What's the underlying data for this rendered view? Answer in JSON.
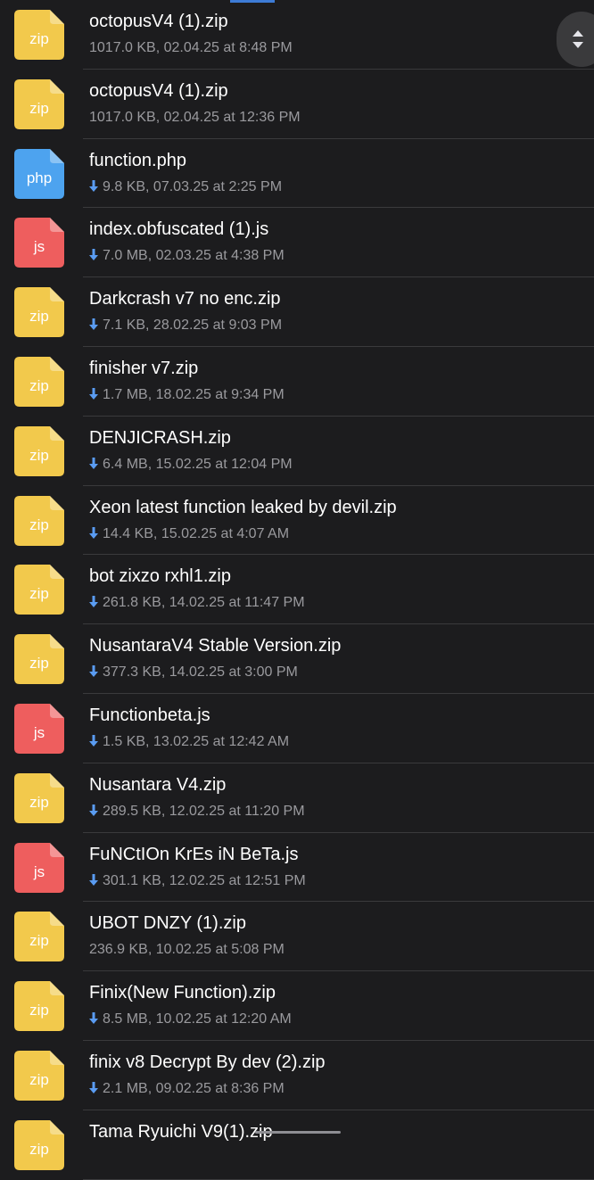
{
  "colors": {
    "zip": "#f2c94c",
    "php": "#4da3ef",
    "js": "#ee5e5e",
    "background": "#1c1c1e",
    "divider": "#3a3a3c",
    "meta_text": "#9a9a9e"
  },
  "files": [
    {
      "name": "octopusV4 (1).zip",
      "meta": "1017.0 KB, 02.04.25 at 8:48 PM",
      "type": "zip",
      "ext_label": "zip",
      "downloaded": false
    },
    {
      "name": "octopusV4 (1).zip",
      "meta": "1017.0 KB, 02.04.25 at 12:36 PM",
      "type": "zip",
      "ext_label": "zip",
      "downloaded": false
    },
    {
      "name": "function.php",
      "meta": "9.8 KB, 07.03.25 at 2:25 PM",
      "type": "php",
      "ext_label": "php",
      "downloaded": true
    },
    {
      "name": "index.obfuscated (1).js",
      "meta": "7.0 MB, 02.03.25 at 4:38 PM",
      "type": "js",
      "ext_label": "js",
      "downloaded": true
    },
    {
      "name": "Darkcrash v7 no enc.zip",
      "meta": "7.1 KB, 28.02.25 at 9:03 PM",
      "type": "zip",
      "ext_label": "zip",
      "downloaded": true
    },
    {
      "name": "finisher v7.zip",
      "meta": "1.7 MB, 18.02.25 at 9:34 PM",
      "type": "zip",
      "ext_label": "zip",
      "downloaded": true
    },
    {
      "name": "DENJICRASH.zip",
      "meta": "6.4 MB, 15.02.25 at 12:04 PM",
      "type": "zip",
      "ext_label": "zip",
      "downloaded": true
    },
    {
      "name": "Xeon latest function leaked by devil.zip",
      "meta": "14.4 KB, 15.02.25 at 4:07 AM",
      "type": "zip",
      "ext_label": "zip",
      "downloaded": true
    },
    {
      "name": "bot zixzo rxhl1.zip",
      "meta": "261.8 KB, 14.02.25 at 11:47 PM",
      "type": "zip",
      "ext_label": "zip",
      "downloaded": true
    },
    {
      "name": "NusantaraV4 Stable Version.zip",
      "meta": "377.3 KB, 14.02.25 at 3:00 PM",
      "type": "zip",
      "ext_label": "zip",
      "downloaded": true
    },
    {
      "name": "Functionbeta.js",
      "meta": "1.5 KB, 13.02.25 at 12:42 AM",
      "type": "js",
      "ext_label": "js",
      "downloaded": true
    },
    {
      "name": "Nusantara V4.zip",
      "meta": "289.5 KB, 12.02.25 at 11:20 PM",
      "type": "zip",
      "ext_label": "zip",
      "downloaded": true
    },
    {
      "name": "FuNCtIOn KrEs iN BeTa.js",
      "meta": "301.1 KB, 12.02.25 at 12:51 PM",
      "type": "js",
      "ext_label": "js",
      "downloaded": true
    },
    {
      "name": "UBOT DNZY (1).zip",
      "meta": "236.9 KB, 10.02.25 at 5:08 PM",
      "type": "zip",
      "ext_label": "zip",
      "downloaded": false
    },
    {
      "name": "Finix(New  Function).zip",
      "meta": "8.5 MB, 10.02.25 at 12:20 AM",
      "type": "zip",
      "ext_label": "zip",
      "downloaded": true
    },
    {
      "name": "finix v8 Decrypt By dev (2).zip",
      "meta": "2.1 MB, 09.02.25 at 8:36 PM",
      "type": "zip",
      "ext_label": "zip",
      "downloaded": true
    },
    {
      "name": "Tama Ryuichi V9(1).zip",
      "meta": "",
      "type": "zip",
      "ext_label": "zip",
      "downloaded": false
    }
  ],
  "icons": {
    "download": "arrow-down-icon",
    "scroll": "scroll-up-down-icon"
  }
}
